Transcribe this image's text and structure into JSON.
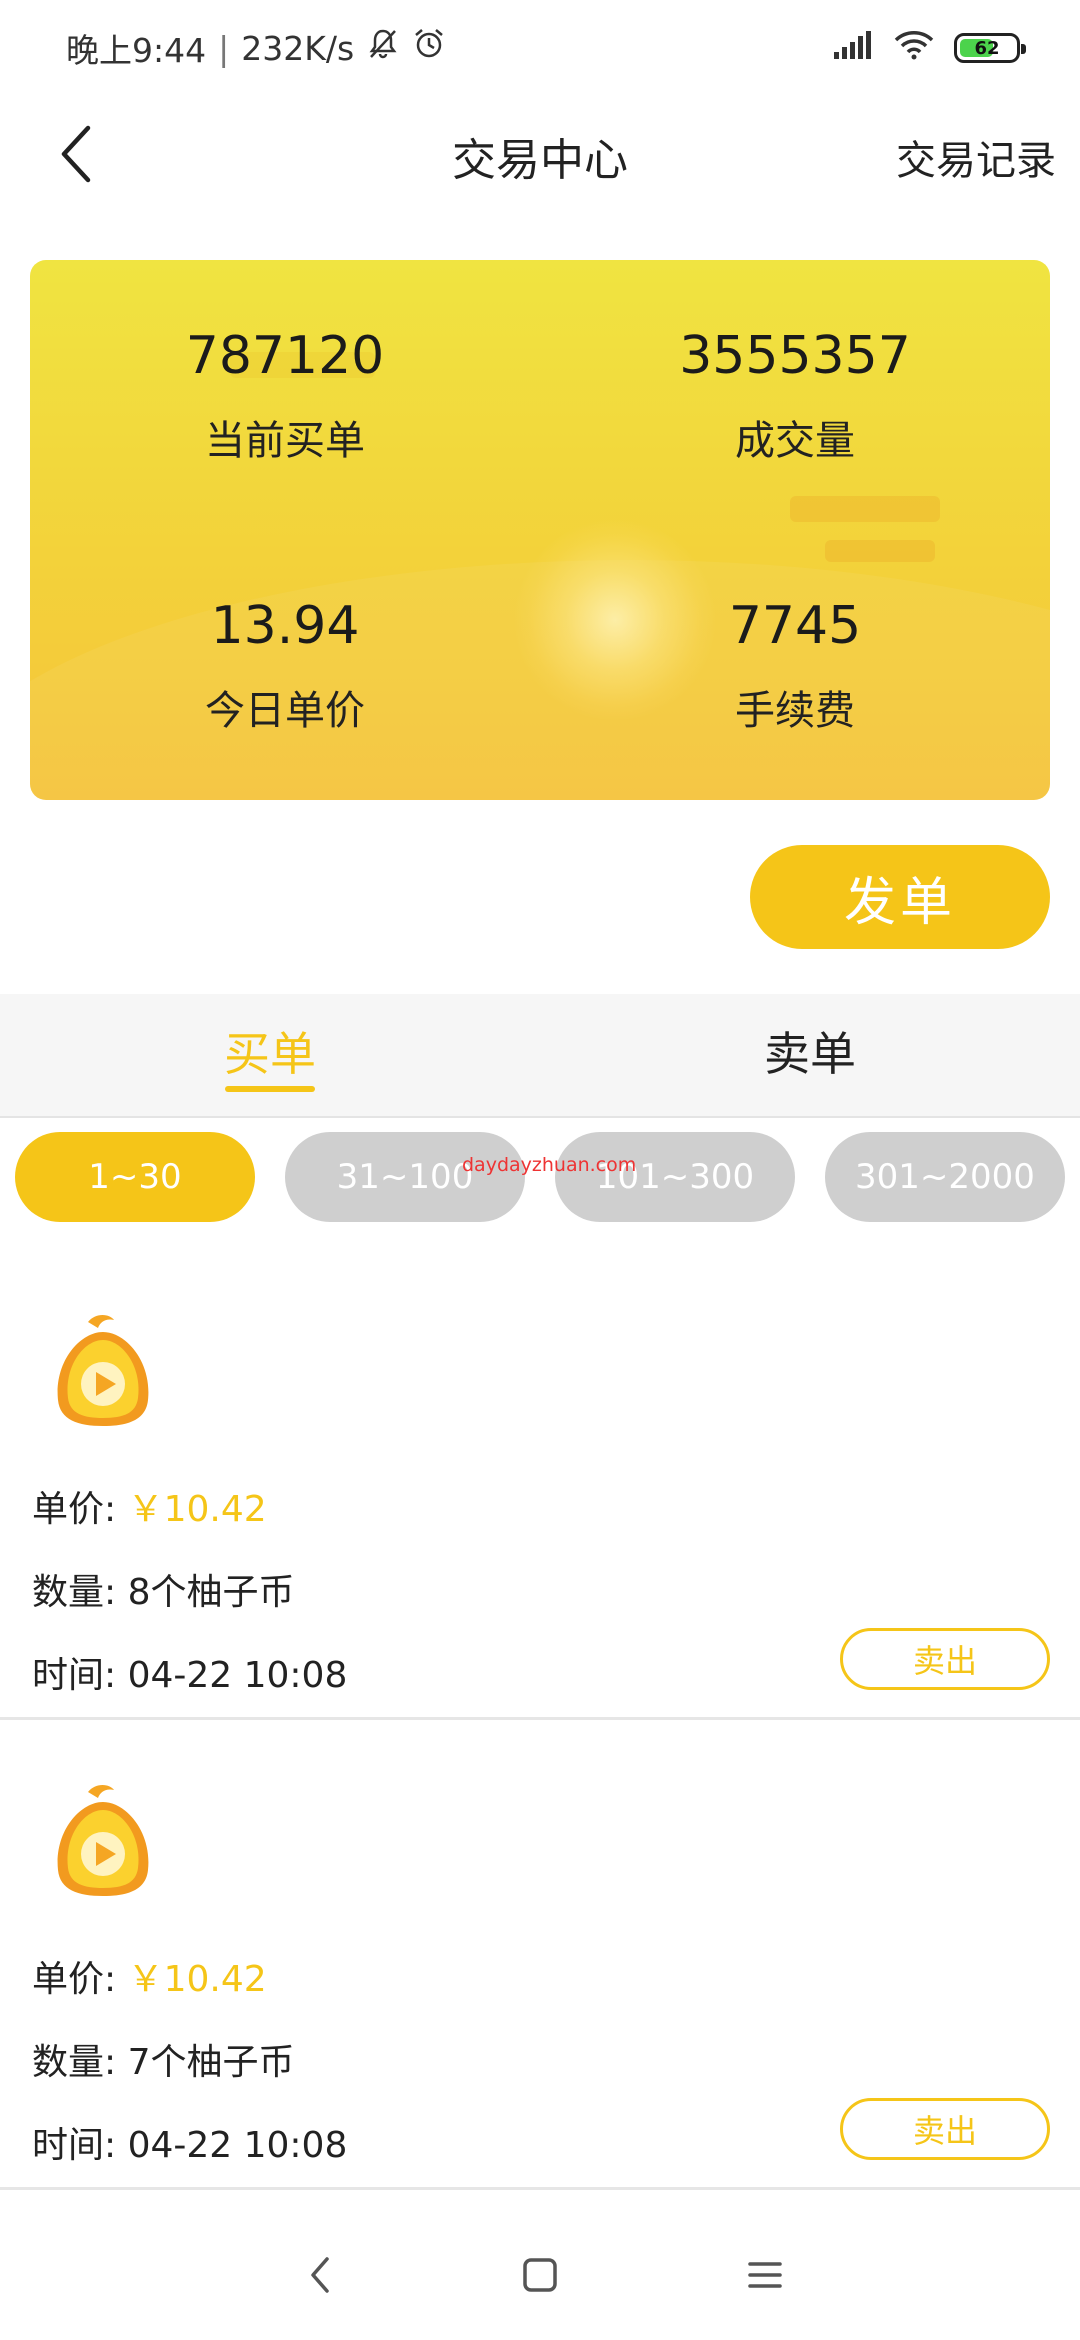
{
  "status_bar": {
    "time": "晚上9:44",
    "separator": "|",
    "speed": "232K/s",
    "battery": "62",
    "battery_level": 0.62,
    "icons": [
      "bell-off-icon",
      "alarm-icon",
      "signal-icon",
      "wifi-icon",
      "battery-icon"
    ]
  },
  "header": {
    "title": "交易中心",
    "records_link": "交易记录"
  },
  "stats": [
    {
      "value": "787120",
      "label": "当前买单"
    },
    {
      "value": "3555357",
      "label": "成交量"
    },
    {
      "value": "13.94",
      "label": "今日单价"
    },
    {
      "value": "7745",
      "label": "手续费"
    }
  ],
  "post_button": "发单",
  "tabs": [
    {
      "label": "买单",
      "active": true
    },
    {
      "label": "卖单",
      "active": false
    }
  ],
  "filters": [
    {
      "label": "1~30",
      "active": true
    },
    {
      "label": "31~100",
      "active": false
    },
    {
      "label": "101~300",
      "active": false
    },
    {
      "label": "301~2000",
      "active": false
    }
  ],
  "watermark": "daydayzhuan.com",
  "orders": [
    {
      "price_label": "单价: ",
      "price_value": "￥10.42",
      "quantity": "数量: 8个柚子币",
      "time": "时间: 04-22 10:08",
      "action": "卖出"
    },
    {
      "price_label": "单价: ",
      "price_value": "￥10.42",
      "quantity": "数量: 7个柚子币",
      "time": "时间: 04-22 10:08",
      "action": "卖出"
    }
  ],
  "colors": {
    "accent": "#f5c518",
    "card_top": "#f0e441",
    "card_bottom": "#f5c33a",
    "inactive_filter": "#cfcfcf",
    "tab_bg": "#f6f6f6"
  },
  "nav_icons": [
    "nav-back-icon",
    "nav-home-icon",
    "nav-menu-icon"
  ]
}
